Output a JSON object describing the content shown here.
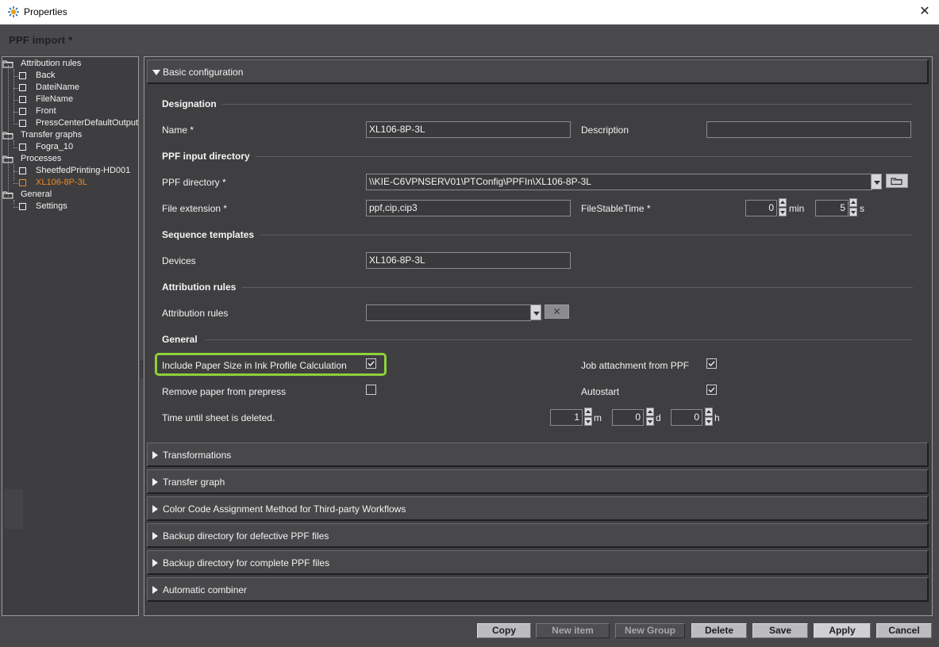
{
  "window": {
    "title": "Properties",
    "close_glyph": "✕",
    "app_icon": "properties-gear-icon"
  },
  "page_title": "PPF import *",
  "tree": {
    "groups": [
      {
        "label": "Attribution rules",
        "items": [
          "Back",
          "DateiName",
          "FileName",
          "Front",
          "PressCenterDefaultOutput"
        ]
      },
      {
        "label": "Transfer graphs",
        "items": [
          "Fogra_10"
        ]
      },
      {
        "label": "Processes",
        "items": [
          "SheetfedPrinting-HD001",
          "XL106-8P-3L"
        ]
      },
      {
        "label": "General",
        "items": [
          "Settings"
        ]
      }
    ],
    "active_item": "XL106-8P-3L"
  },
  "sections": {
    "basic": "Basic configuration",
    "collapsed": [
      "Transformations",
      "Transfer graph",
      "Color Code Assignment Method for Third-party Workflows",
      "Backup directory for defective PPF files",
      "Backup directory for complete PPF files",
      "Automatic combiner"
    ]
  },
  "form": {
    "designation": {
      "title": "Designation",
      "name_label": "Name *",
      "name_value": "XL106-8P-3L",
      "description_label": "Description",
      "description_value": ""
    },
    "input_dir": {
      "title": "PPF input directory",
      "dir_label": "PPF directory *",
      "dir_value": "\\\\KIE-C6VPNSERV01\\PTConfig\\PPFIn\\XL106-8P-3L",
      "ext_label": "File extension *",
      "ext_value": "ppf,cip,cip3",
      "stable_label": "FileStableTime *",
      "stable_min": "0",
      "stable_min_unit": "min",
      "stable_sec": "5",
      "stable_sec_unit": "s"
    },
    "sequence": {
      "title": "Sequence templates",
      "devices_label": "Devices",
      "devices_value": "XL106-8P-3L"
    },
    "attribution": {
      "title": "Attribution rules",
      "rules_label": "Attribution rules",
      "rules_value": "",
      "clear_glyph": "✕"
    },
    "general": {
      "title": "General",
      "paper_size_label": "Include Paper Size in Ink Profile Calculation",
      "paper_size_checked": true,
      "remove_paper_label": "Remove paper from prepress",
      "remove_paper_checked": false,
      "job_attach_label": "Job attachment from PPF",
      "job_attach_checked": true,
      "autostart_label": "Autostart",
      "autostart_checked": true,
      "time_label": "Time until sheet is deleted.",
      "time_m": "1",
      "time_m_unit": "m",
      "time_d": "0",
      "time_d_unit": "d",
      "time_h": "0",
      "time_h_unit": "h"
    }
  },
  "buttons": {
    "copy": "Copy",
    "new_item": "New item",
    "new_group": "New Group",
    "delete": "Delete",
    "save": "Save",
    "apply": "Apply",
    "cancel": "Cancel"
  },
  "colors": {
    "active_tree_item": "#f08a1c",
    "highlight_ring": "#8fd13a",
    "panel_background": "#3f3f41"
  }
}
